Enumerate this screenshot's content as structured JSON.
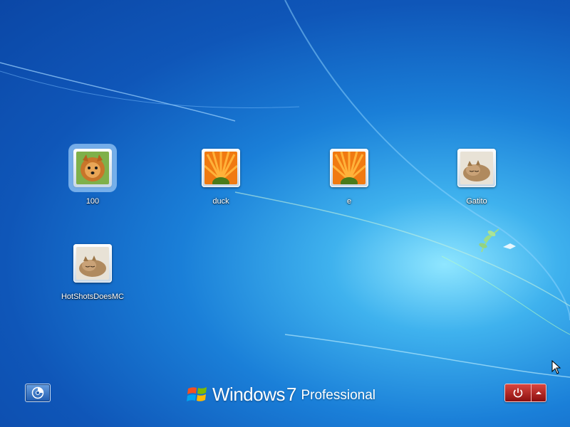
{
  "users": [
    {
      "name": "100",
      "picture": "pomeranian-dog",
      "selected": true
    },
    {
      "name": "duck",
      "picture": "orange-flower"
    },
    {
      "name": "e",
      "picture": "orange-flower"
    },
    {
      "name": "Gatito",
      "picture": "sleeping-kitten"
    },
    {
      "name": "HotShotsDoesMC",
      "picture": "sleeping-kitten"
    }
  ],
  "branding": {
    "word": "Windows",
    "version": "7",
    "edition": "Professional"
  },
  "buttons": {
    "ease_of_access": "ease-of-access-icon",
    "shutdown": "power-icon",
    "shutdown_options": "arrow-up-icon"
  },
  "colors": {
    "background": "#1a7fd8",
    "power": "#b3231d"
  }
}
